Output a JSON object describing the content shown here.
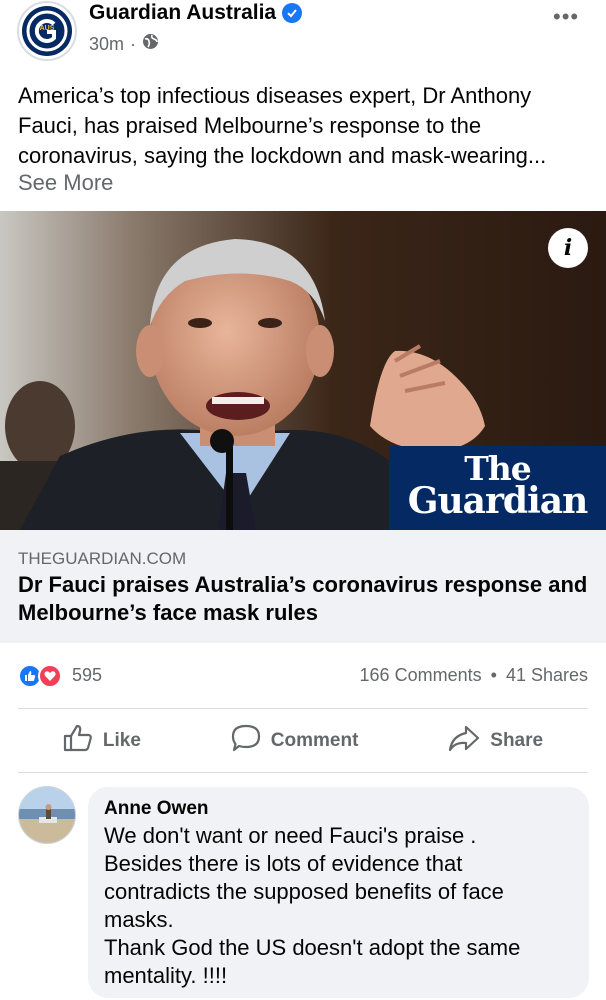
{
  "post": {
    "page_name": "Guardian Australia",
    "avatar_badge": "AUS",
    "time": "30m",
    "dot": "·",
    "more_label": "•••",
    "text": "America’s top infectious diseases expert, Dr Anthony Fauci, has praised Melbourne’s response to the coronavirus, saying the lockdown and mask-wearing...",
    "see_more": "See More"
  },
  "image": {
    "info_label": "i",
    "logo_line1": "The",
    "logo_line2": "Guardian"
  },
  "link": {
    "domain": "THEGUARDIAN.COM",
    "title": "Dr Fauci praises Australia’s coronavirus response and Melbourne’s face mask rules"
  },
  "stats": {
    "reactions_count": "595",
    "comments": "166 Comments",
    "separator": "•",
    "shares": "41 Shares"
  },
  "actions": {
    "like": "Like",
    "comment": "Comment",
    "share": "Share"
  },
  "comment": {
    "author": "Anne Owen",
    "text": "We don't want or need Fauci's praise .\nBesides there is lots of evidence that contradicts the supposed benefits of face masks.\nThank God the US doesn't adopt the same mentality. !!!!"
  },
  "colors": {
    "brand_blue": "#1877f2",
    "guardian_blue": "#052962",
    "love_red": "#f33e58",
    "secondary_text": "#65676b"
  }
}
